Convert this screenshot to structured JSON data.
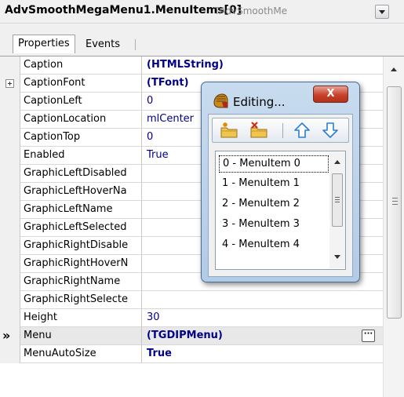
{
  "inspector": {
    "object_name": "AdvSmoothMegaMenu1.MenuItems[0]",
    "object_type": "TAdvSmoothMe"
  },
  "tabs": [
    {
      "label": "Properties",
      "active": true
    },
    {
      "label": "Events",
      "active": false
    }
  ],
  "properties": [
    {
      "name": "Caption",
      "value": "(HTMLString)",
      "bold": true
    },
    {
      "name": "CaptionFont",
      "value": "(TFont)",
      "bold": true,
      "expandable": true
    },
    {
      "name": "CaptionLeft",
      "value": "0"
    },
    {
      "name": "CaptionLocation",
      "value": "mlCenter"
    },
    {
      "name": "CaptionTop",
      "value": "0"
    },
    {
      "name": "Enabled",
      "value": "True"
    },
    {
      "name": "GraphicLeftDisabled",
      "value": ""
    },
    {
      "name": "GraphicLeftHoverNa",
      "value": ""
    },
    {
      "name": "GraphicLeftName",
      "value": ""
    },
    {
      "name": "GraphicLeftSelected",
      "value": ""
    },
    {
      "name": "GraphicRightDisable",
      "value": ""
    },
    {
      "name": "GraphicRightHoverN",
      "value": ""
    },
    {
      "name": "GraphicRightName",
      "value": ""
    },
    {
      "name": "GraphicRightSelecte",
      "value": ""
    },
    {
      "name": "Height",
      "value": "30"
    },
    {
      "name": "Menu",
      "value": "(TGDIPMenu)",
      "bold": true,
      "selected": true,
      "marker": "»",
      "button": "···"
    },
    {
      "name": "MenuAutoSize",
      "value": "True",
      "bold": true
    }
  ],
  "editor_dialog": {
    "title": "Editing...",
    "close_label": "X",
    "toolbar": [
      {
        "icon": "add-item-icon",
        "label": "Add"
      },
      {
        "icon": "delete-item-icon",
        "label": "Delete"
      },
      {
        "icon": "move-up-icon",
        "label": "Move Up"
      },
      {
        "icon": "move-down-icon",
        "label": "Move Down"
      }
    ],
    "items": [
      "0 - MenuItem 0",
      "1 - MenuItem 1",
      "2 - MenuItem 2",
      "3 - MenuItem 3",
      "4 - MenuItem 4"
    ],
    "selected_index": 0
  },
  "colors": {
    "value_text": "#00008b",
    "dialog_frame": "#b8d0ea",
    "close_button": "#c7412b"
  }
}
